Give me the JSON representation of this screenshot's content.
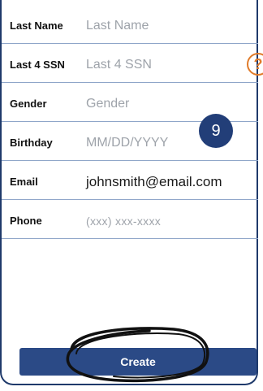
{
  "form": {
    "rows": [
      {
        "label": "Last Name",
        "placeholder": "Last Name",
        "value": ""
      },
      {
        "label": "Last 4 SSN",
        "placeholder": "Last 4 SSN",
        "value": ""
      },
      {
        "label": "Gender",
        "placeholder": "Gender",
        "value": ""
      },
      {
        "label": "Birthday",
        "placeholder": "MM/DD/YYYY",
        "value": ""
      },
      {
        "label": "Email",
        "placeholder": "",
        "value": "johnsmith@email.com"
      },
      {
        "label": "Phone",
        "placeholder": "(xxx) xxx-xxxx",
        "value": ""
      }
    ],
    "help_icon_glyph": "?",
    "create_label": "Create"
  },
  "annotation": {
    "step_number": "9"
  },
  "colors": {
    "primary": "#2b4a86",
    "accent": "#e07b2a",
    "divider": "#8fa6c9"
  }
}
